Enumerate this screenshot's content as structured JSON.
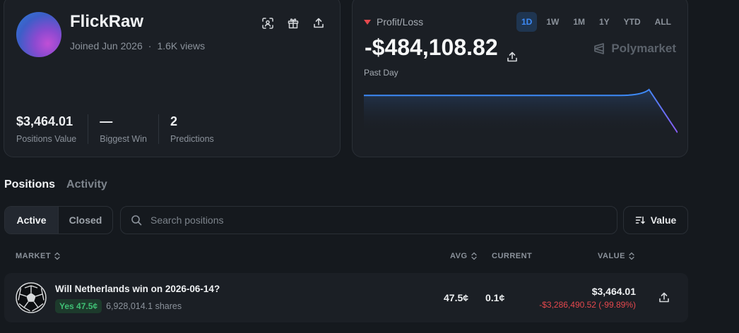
{
  "profile": {
    "name": "FlickRaw",
    "joined": "Joined Jun 2026",
    "separator": "·",
    "views": "1.6K views",
    "stats": [
      {
        "value": "$3,464.01",
        "label": "Positions Value"
      },
      {
        "value": "—",
        "label": "Biggest Win"
      },
      {
        "value": "2",
        "label": "Predictions"
      }
    ],
    "icons": [
      "qr-scan-icon",
      "gift-icon",
      "share-icon"
    ]
  },
  "pnl": {
    "label": "Profit/Loss",
    "value": "-$484,108.82",
    "period": "Past Day",
    "brand": "Polymarket",
    "ranges": [
      "1D",
      "1W",
      "1M",
      "1Y",
      "YTD",
      "ALL"
    ],
    "active_range": "1D",
    "chart_data": {
      "type": "area",
      "series": [
        {
          "values": [
            0,
            0,
            0,
            0,
            0,
            0,
            0,
            0,
            0,
            0,
            0.02,
            -1
          ]
        }
      ],
      "grid": false
    },
    "colors": {
      "line": "#3d8af7",
      "down": "#e5484d"
    }
  },
  "tabs": [
    {
      "label": "Positions",
      "active": true
    },
    {
      "label": "Activity",
      "active": false
    }
  ],
  "filters": {
    "active_label": "Active",
    "closed_label": "Closed",
    "search_placeholder": "Search positions",
    "sort_label": "Value"
  },
  "table": {
    "headers": {
      "market": "MARKET",
      "avg": "AVG",
      "current": "CURRENT",
      "value": "VALUE"
    },
    "rows": [
      {
        "question": "Will Netherlands win on 2026-06-14?",
        "outcome": "Yes 47.5¢",
        "shares": "6,928,014.1 shares",
        "avg": "47.5¢",
        "current": "0.1¢",
        "value": "$3,464.01",
        "change": "-$3,286,490.52 (-99.89%)"
      }
    ]
  }
}
